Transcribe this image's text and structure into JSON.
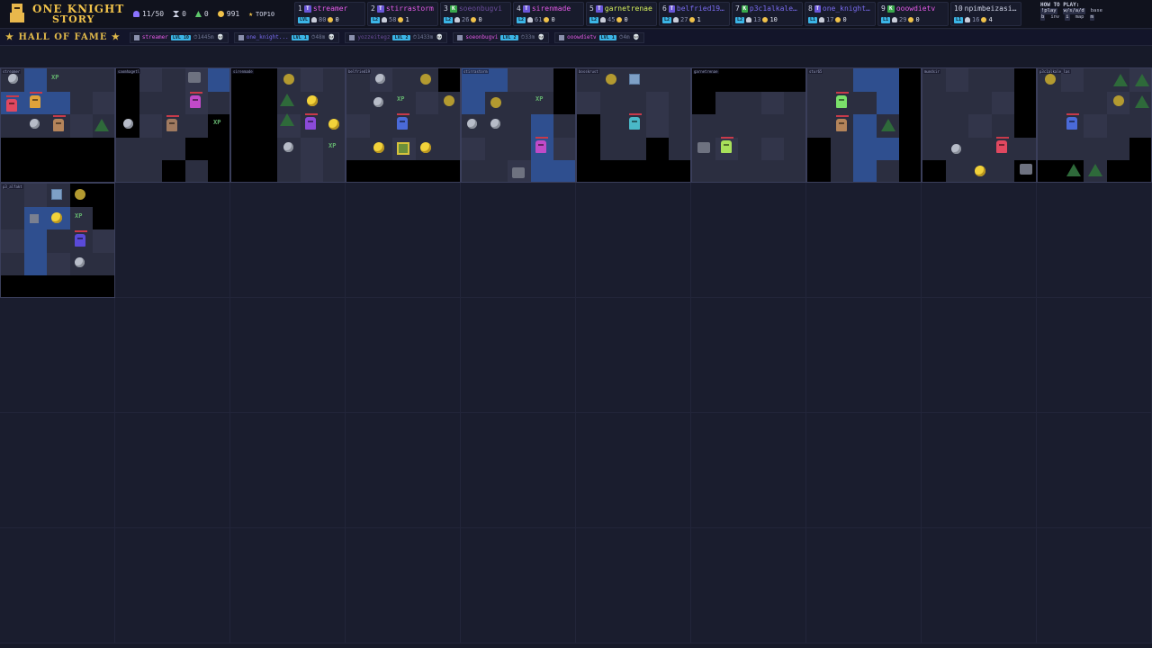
{
  "app": {
    "title_line1": "ONE KNIGHT",
    "title_line2": "STORY"
  },
  "stats": {
    "players": "11/50",
    "hours": "0",
    "kills": "0",
    "coins": "991",
    "top10_label": "TOP10"
  },
  "leaderboard": [
    {
      "rank": "1",
      "cls": "T",
      "name": "streamer",
      "name_color": "#e55be8",
      "lvl": "LVL",
      "kills": "80",
      "coins": "0"
    },
    {
      "rank": "2",
      "cls": "T",
      "name": "stirrastorm",
      "name_color": "#e55be8",
      "lvl": "L2",
      "kills": "58",
      "coins": "1"
    },
    {
      "rank": "3",
      "cls": "K",
      "name": "soeonbugvi",
      "name_color": "#6a4c9a",
      "lvl": "L2",
      "kills": "26",
      "coins": "0"
    },
    {
      "rank": "4",
      "cls": "T",
      "name": "sirenmade",
      "name_color": "#e55be8",
      "lvl": "L2",
      "kills": "61",
      "coins": "0"
    },
    {
      "rank": "5",
      "cls": "T",
      "name": "garnetrenae",
      "name_color": "#d8f25c",
      "lvl": "L2",
      "kills": "45",
      "coins": "0"
    },
    {
      "rank": "6",
      "cls": "T",
      "name": "belfried19...",
      "name_color": "#7a6cf0",
      "lvl": "L2",
      "kills": "27",
      "coins": "1"
    },
    {
      "rank": "7",
      "cls": "K",
      "name": "p3c1alkale...",
      "name_color": "#7a6cf0",
      "lvl": "L2",
      "kills": "13",
      "coins": "10"
    },
    {
      "rank": "8",
      "cls": "T",
      "name": "one_knight...",
      "name_color": "#7a6cf0",
      "lvl": "L1",
      "kills": "17",
      "coins": "0"
    },
    {
      "rank": "9",
      "cls": "K",
      "name": "ooowdietv",
      "name_color": "#e55be8",
      "lvl": "L1",
      "kills": "29",
      "coins": "0"
    },
    {
      "rank": "10",
      "cls": "",
      "name": "npimbeizasi...",
      "name_color": "#cfd3e6",
      "lvl": "L1",
      "kills": "16",
      "coins": "4"
    }
  ],
  "howto": {
    "title": "HOW TO PLAY:",
    "play_key": "!play",
    "move_keys": "w/s/a/d",
    "move_label": "base",
    "inv_key": "b",
    "inv_label": "inv",
    "info_key": "i",
    "map_label": "map",
    "map_key": "m"
  },
  "hall_of_fame": {
    "title": "★ HALL OF FAME ★",
    "entries": [
      {
        "name": "streamer",
        "name_color": "#e55be8",
        "lvl": "LVL 10",
        "meta": "⏱1445m 💀"
      },
      {
        "name": "one_knight...",
        "name_color": "#7a6cf0",
        "lvl": "LVL 1",
        "meta": "⏱48m 💀"
      },
      {
        "name": "yozzeitegz",
        "name_color": "#6a4c9a",
        "lvl": "LVL 2",
        "meta": "⏱1433m 💀"
      },
      {
        "name": "soeonbugvi",
        "name_color": "#e55be8",
        "lvl": "LVL 2",
        "meta": "⏱33m 💀"
      },
      {
        "name": "ooowdietv",
        "name_color": "#e55be8",
        "lvl": "LVL 1",
        "meta": "⏱4m 💀"
      }
    ]
  },
  "zones": [
    {
      "tag": "streamer"
    },
    {
      "tag": "saomhagetl"
    },
    {
      "tag": "sirenmade"
    },
    {
      "tag": "belfried19"
    },
    {
      "tag": "stirrastorm"
    },
    {
      "tag": "bosskrust"
    },
    {
      "tag": "garnetrenae"
    },
    {
      "tag": "stur65"
    },
    {
      "tag": "mundsir"
    },
    {
      "tag": "p3c1alkale_las"
    },
    {
      "tag": "p3_alfakt"
    }
  ],
  "entity_labels": {
    "hero_streamer": "streamer",
    "deer1": "Deer",
    "wolf1": "Wolf",
    "bosskrust": "bosskr",
    "garnet": "garnet",
    "stur": "stur65",
    "troll": "Troll",
    "xp": "XP"
  },
  "colors": {
    "background": "#171a29",
    "accent_gold": "#f0c24a",
    "level_badge": "#3bb5e6",
    "water": "#2f4f8f"
  }
}
